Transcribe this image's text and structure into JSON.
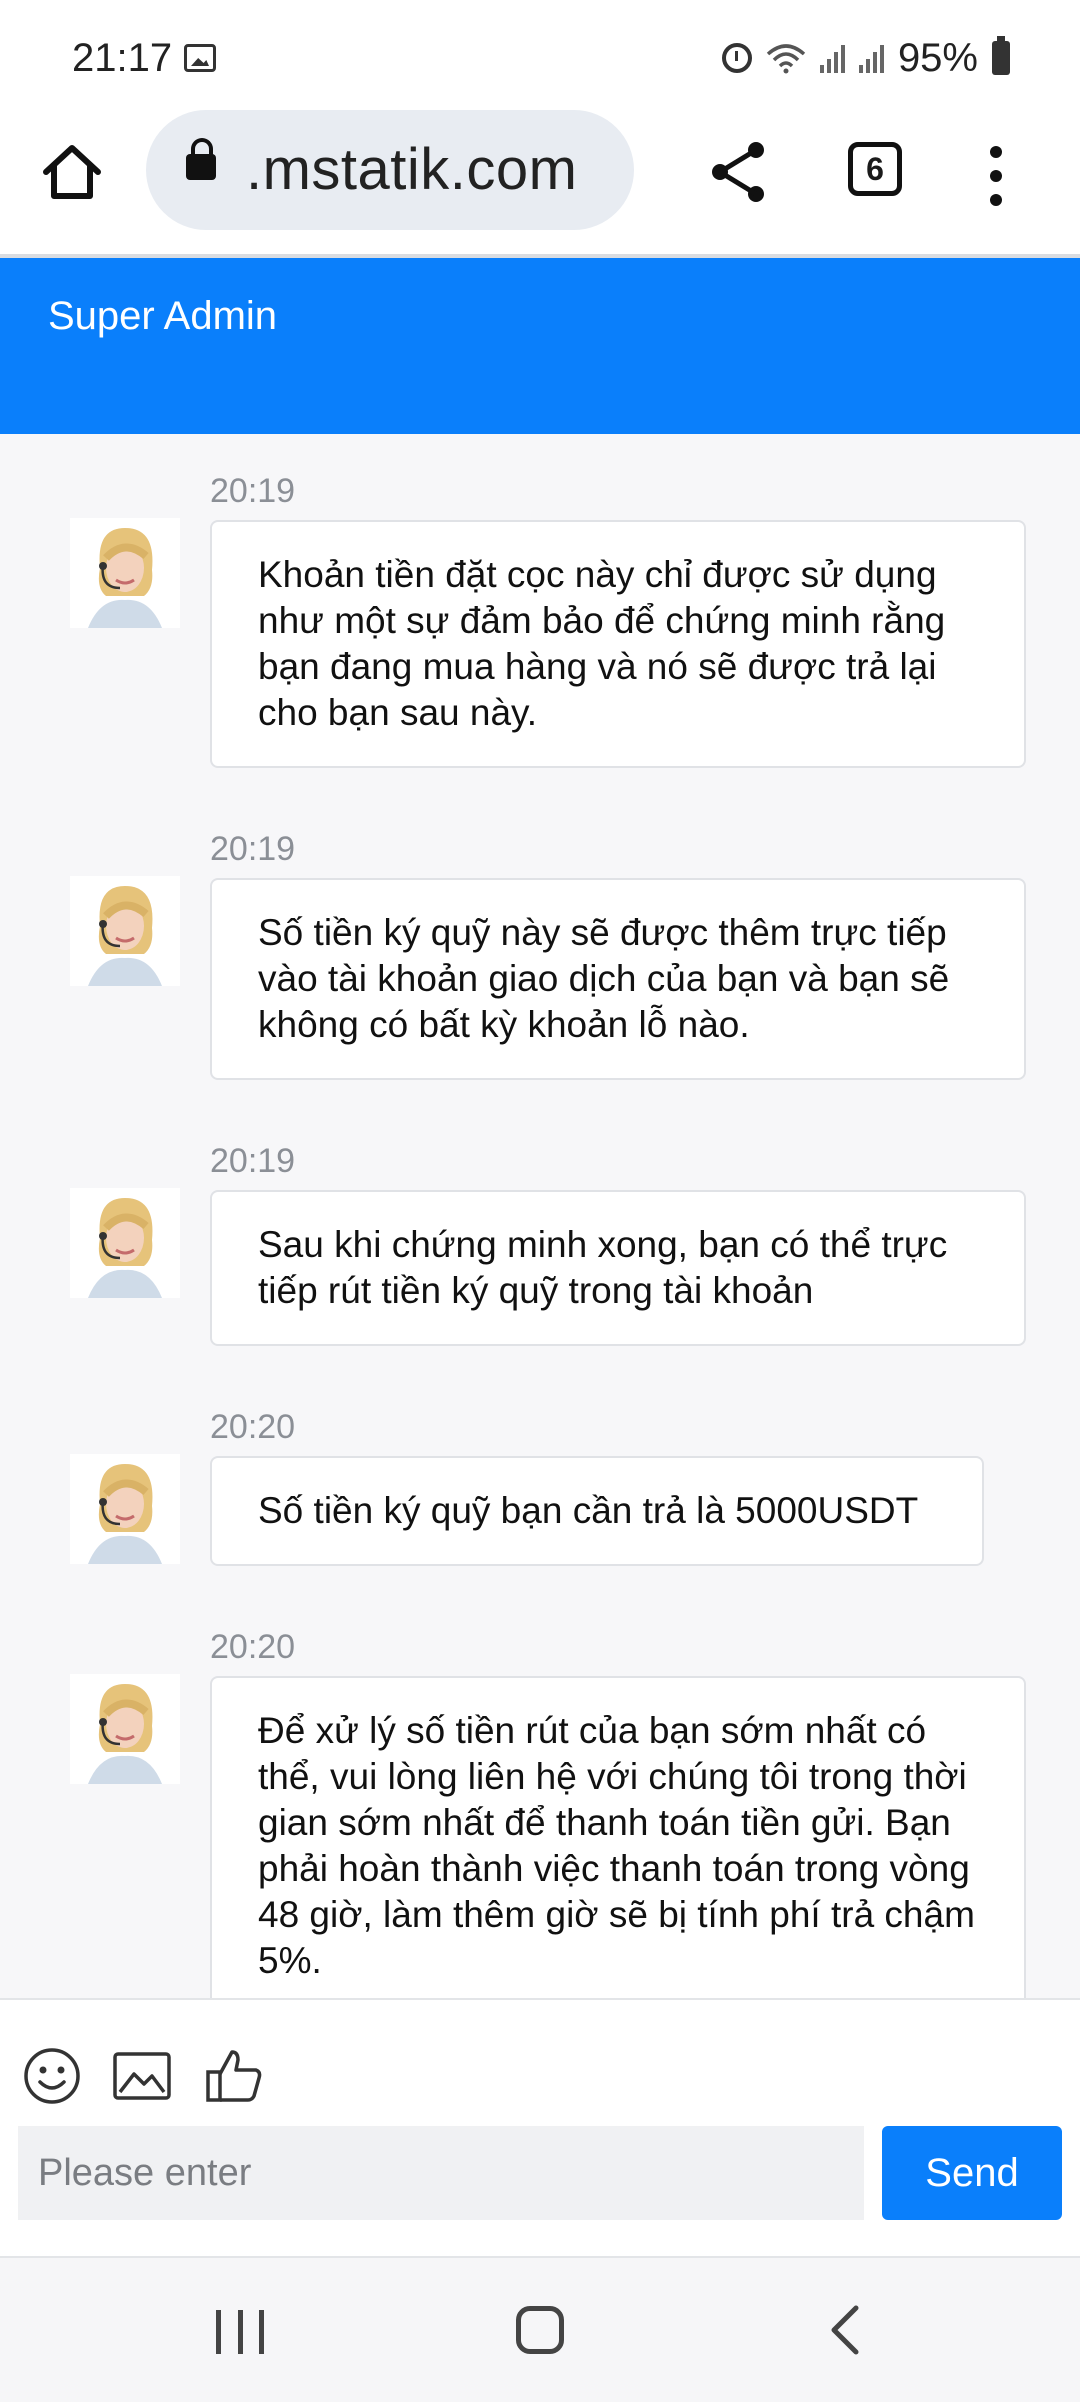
{
  "status_bar": {
    "time": "21:17",
    "battery": "95%",
    "icons": [
      "gallery-icon",
      "alarm-icon",
      "wifi-icon",
      "signal-icon",
      "signal-icon",
      "battery-icon"
    ]
  },
  "browser": {
    "url": ".mstatik.com",
    "tab_count": "6"
  },
  "chat": {
    "title": "Super Admin",
    "messages": [
      {
        "time": "20:19",
        "text": "Khoản tiền đặt cọc này chỉ được sử dụng như một sự đảm bảo để chứng minh rằng bạn đang mua hàng và nó sẽ được trả lại cho bạn sau này."
      },
      {
        "time": "20:19",
        "text": "Số tiền ký quỹ này sẽ được thêm trực tiếp vào tài khoản giao dịch của bạn và bạn sẽ không có bất kỳ khoản lỗ nào."
      },
      {
        "time": "20:19",
        "text": "Sau khi chứng minh xong, bạn có thể trực tiếp rút tiền ký quỹ trong tài khoản"
      },
      {
        "time": "20:20",
        "text": "Số tiền ký quỹ bạn cần trả là 5000USDT"
      },
      {
        "time": "20:20",
        "text": "Để xử lý số tiền rút của bạn sớm nhất có thể, vui lòng liên hệ với chúng tôi trong thời gian sớm nhất để thanh toán tiền gửi. Bạn phải hoàn thành việc thanh toán trong vòng 48 giờ, làm thêm giờ sẽ bị tính phí trả chậm 5%."
      }
    ]
  },
  "composer": {
    "placeholder": "Please enter",
    "send_label": "Send",
    "tools": [
      "emoji-icon",
      "image-icon",
      "thumbs-up-icon"
    ]
  },
  "colors": {
    "accent": "#0a7ffb",
    "background": "#f7f7f9"
  }
}
